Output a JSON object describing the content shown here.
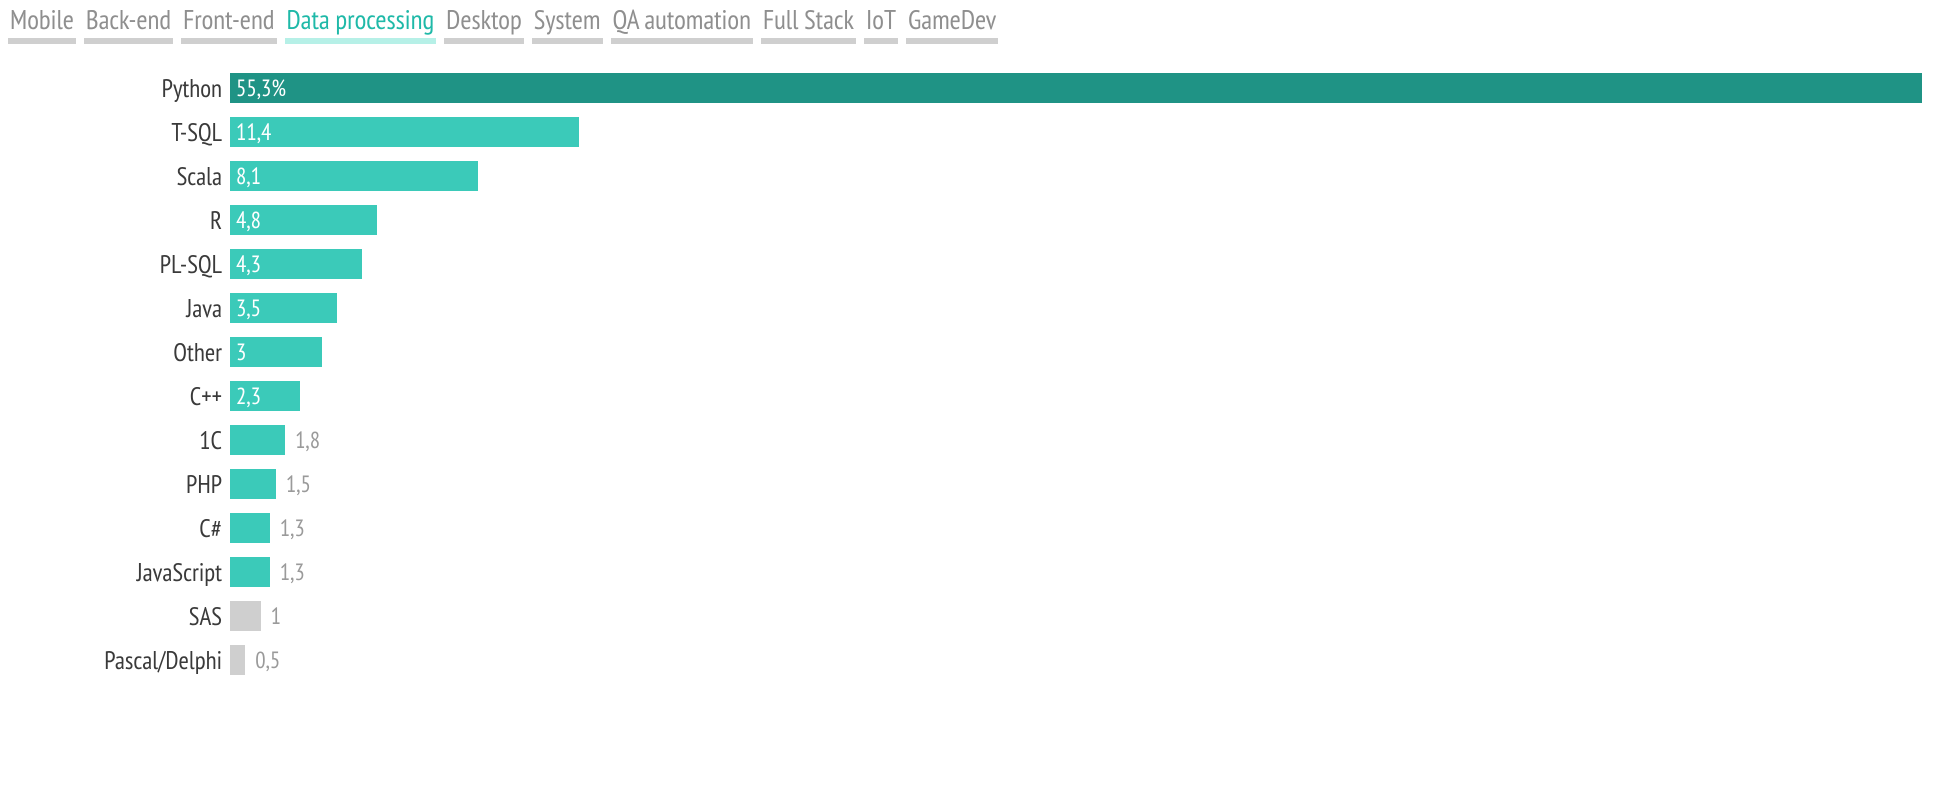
{
  "tabs": [
    {
      "label": "Mobile",
      "active": false
    },
    {
      "label": "Back-end",
      "active": false
    },
    {
      "label": "Front-end",
      "active": false
    },
    {
      "label": "Data processing",
      "active": true
    },
    {
      "label": "Desktop",
      "active": false
    },
    {
      "label": "System",
      "active": false
    },
    {
      "label": "QA automation",
      "active": false
    },
    {
      "label": "Full Stack",
      "active": false
    },
    {
      "label": "IoT",
      "active": false
    },
    {
      "label": "GameDev",
      "active": false
    }
  ],
  "colors": {
    "bar_primary": "#1f9385",
    "bar_secondary": "#3bcab9",
    "bar_muted": "#cfcfcf"
  },
  "chart_layout": {
    "max_value": 55.3,
    "inside_label_threshold": 2.0,
    "muted_threshold": 1.0
  },
  "chart_data": {
    "type": "bar",
    "title": "",
    "xlabel": "",
    "ylabel": "",
    "xlim": [
      0,
      55.3
    ],
    "categories": [
      "Python",
      "T-SQL",
      "Scala",
      "R",
      "PL-SQL",
      "Java",
      "Other",
      "C++",
      "1C",
      "PHP",
      "C#",
      "JavaScript",
      "SAS",
      "Pascal/Delphi"
    ],
    "values": [
      55.3,
      11.4,
      8.1,
      4.8,
      4.3,
      3.5,
      3.0,
      2.3,
      1.8,
      1.5,
      1.3,
      1.3,
      1.0,
      0.5
    ],
    "value_labels": [
      "55,3%",
      "11,4",
      "8,1",
      "4,8",
      "4,3",
      "3,5",
      "3",
      "2,3",
      "1,8",
      "1,5",
      "1,3",
      "1,3",
      "1",
      "0,5"
    ]
  }
}
